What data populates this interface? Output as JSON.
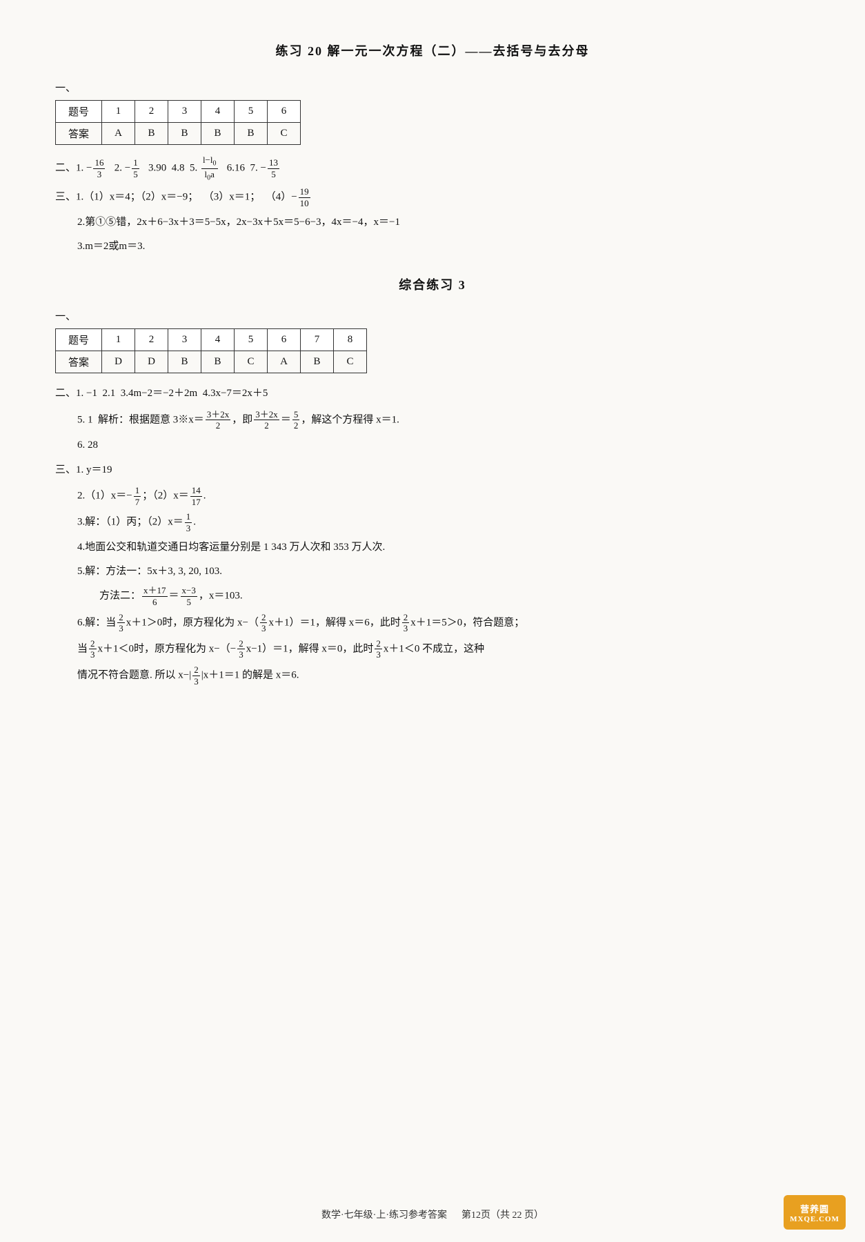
{
  "page": {
    "title1": "练习 20  解一元一次方程（二）——去括号与去分母",
    "section1": {
      "label": "一、",
      "table1": {
        "headers": [
          "题号",
          "1",
          "2",
          "3",
          "4",
          "5",
          "6"
        ],
        "row": [
          "答案",
          "A",
          "B",
          "B",
          "B",
          "B",
          "C"
        ]
      },
      "label2": "二、",
      "answers2": "1. −16/3  2. −1/5  3.90  4.8  5. (l−l₀)/(l₀a)  6.16  7. −13/5",
      "label3": "三、",
      "answers3_1": "1.（1）x＝4；（2）x＝−9；  （3）x＝1；  （4）−19/10",
      "answers3_2": "2.第①⑤错，2x＋6−3x＋3＝5−5x，2x−3x＋5x＝5−6−3，4x＝−4，x＝−1",
      "answers3_3": "3.m＝2或m＝3."
    },
    "title2": "综合练习 3",
    "section2": {
      "label": "一、",
      "table2": {
        "headers": [
          "题号",
          "1",
          "2",
          "3",
          "4",
          "5",
          "6",
          "7",
          "8"
        ],
        "row": [
          "答案",
          "D",
          "D",
          "B",
          "B",
          "C",
          "A",
          "B",
          "C"
        ]
      },
      "label2": "二、",
      "ans2_1": "1. −1  2.1  3.4m−2＝−2＋2m  4.3x−7＝2x＋5",
      "ans2_5_prefix": "5. 1  解析：根据题意 3※x＝",
      "ans2_5_frac1_num": "3＋2x",
      "ans2_5_frac1_den": "2",
      "ans2_5_mid": "，即",
      "ans2_5_frac2_num": "3＋2x",
      "ans2_5_frac2_den": "2",
      "ans2_5_suffix": "＝5/2，解这个方程得 x＝1.",
      "ans2_6": "6. 28",
      "label3": "三、",
      "ans3_1": "1. y＝19",
      "ans3_2_1": "2.（1）x＝−",
      "ans3_2_frac1_num": "1",
      "ans3_2_frac1_den": "7",
      "ans3_2_mid": "；（2）x＝",
      "ans3_2_frac2_num": "14",
      "ans3_2_frac2_den": "17",
      "ans3_2_suffix": ".",
      "ans3_3": "3.解：（1）丙；（2）x＝1/3.",
      "ans3_4": "4.地面公交和轨道交通日均客运量分别是 1 343 万人次和 353 万人次.",
      "ans3_5_a": "5.解：方法一：5x＋3, 3, 20, 103.",
      "ans3_5_b": "方法二：",
      "ans3_5_b_frac1_num": "x＋17",
      "ans3_5_b_frac1_den": "6",
      "ans3_5_b_mid": "＝",
      "ans3_5_b_frac2_num": "x−3",
      "ans3_5_b_frac2_den": "5",
      "ans3_5_b_suffix": "，x＝103.",
      "ans3_6_a": "6.解：当",
      "ans3_6_a_frac_num": "2",
      "ans3_6_a_frac_den": "3",
      "ans3_6_a_mid": "x＋1＞0时，原方程化为 x−（",
      "ans3_6_a_frac2_num": "2",
      "ans3_6_a_frac2_den": "3",
      "ans3_6_a_suffix": "x＋1）＝1，解得 x＝6，此时2/3 x＋1＝5＞0，符合题意；",
      "ans3_6_b": "当2/3 x＋1＜0时，原方程化为 x−（−2/3 x−1）＝1，解得 x＝0，此时2/3 x＋1＜0 不成立，这种",
      "ans3_6_c": "情况不符合题意. 所以 x− |2/3| x＋1＝1 的解是 x＝6."
    },
    "footer": {
      "text": "数学·七年级·上·练习参考答案",
      "page": "第12页（共 22 页）"
    },
    "watermark": {
      "line1": "营养圆",
      "line2": "MXQE.COM"
    }
  }
}
